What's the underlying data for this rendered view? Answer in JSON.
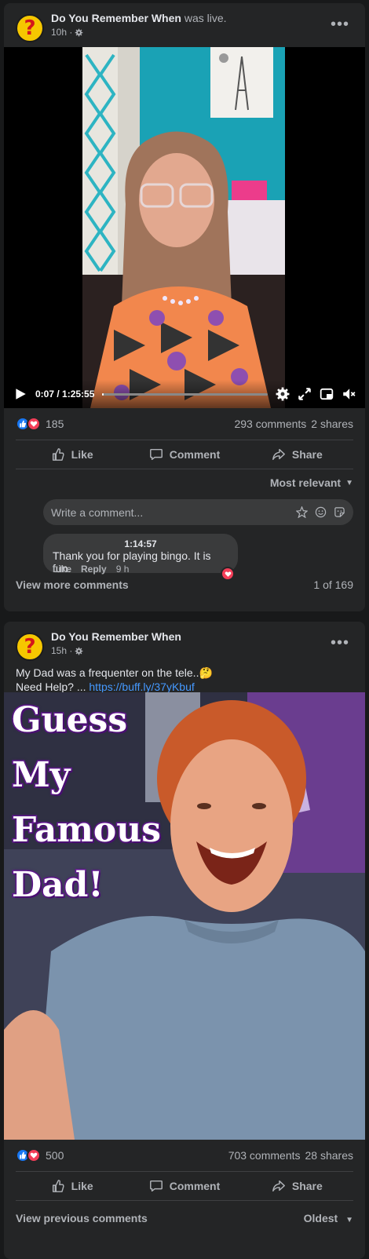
{
  "post1": {
    "author": "Do You Remember When",
    "status": "was live.",
    "time": "10h ·",
    "video": {
      "time": "0:07 / 1:25:55",
      "progress": 0.0014
    },
    "stats": {
      "reactions": "185",
      "comments": "293 comments",
      "shares": "2 shares"
    },
    "actions": {
      "like": "Like",
      "comment": "Comment",
      "share": "Share"
    },
    "sort": "Most relevant",
    "write_placeholder": "Write a comment...",
    "comment": {
      "timestamp": "1:14:57",
      "text": "Thank you for playing bingo. It is fun.",
      "like": "Like",
      "reply": "Reply",
      "age": "9 h"
    },
    "view_more": "View more comments",
    "count": "1 of 169"
  },
  "post2": {
    "author": "Do You Remember When",
    "time": "15h ·",
    "text_line1": "My Dad was a frequenter on the tele..🤔",
    "text_line2_prefix": "Need Help? ... ",
    "link": "https://buff.ly/37yKbuf",
    "image_text": [
      "Guess",
      "My",
      "Famous",
      "Dad!"
    ],
    "stats": {
      "reactions": "500",
      "comments": "703 comments",
      "shares": "28 shares"
    },
    "actions": {
      "like": "Like",
      "comment": "Comment",
      "share": "Share"
    },
    "view_previous": "View previous comments",
    "sort": "Oldest"
  },
  "colors": {
    "accent": "#4599ff",
    "like": "#1877f2",
    "love": "#f33e58",
    "avatar": "#f6c700"
  }
}
